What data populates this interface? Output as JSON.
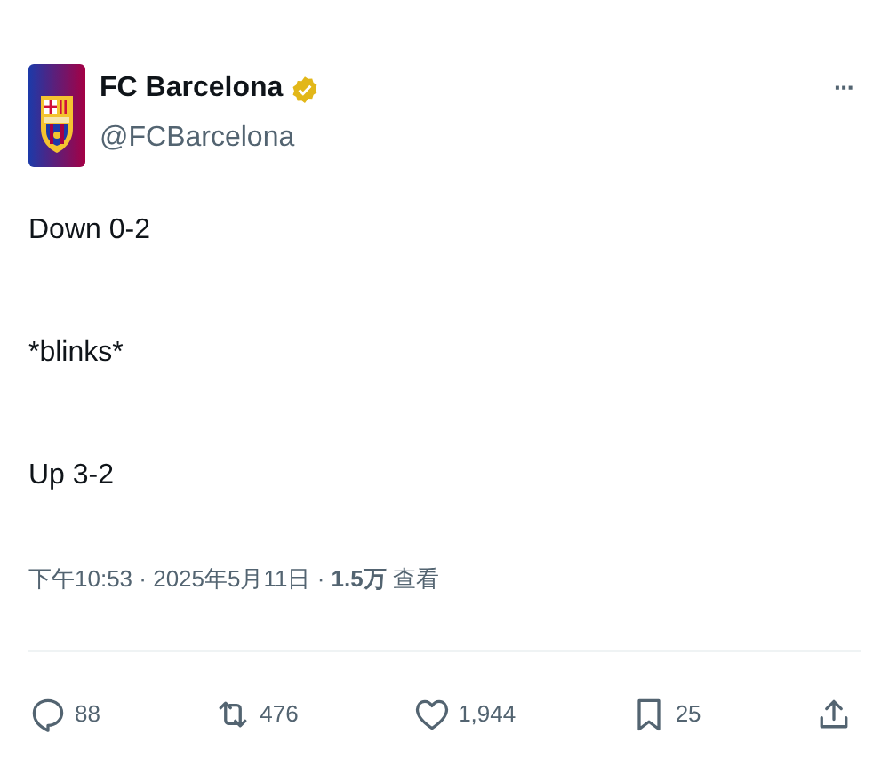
{
  "author": {
    "name": "FC Barcelona",
    "verified": true,
    "handle": "@FCBarcelona"
  },
  "more": "···",
  "lines": [
    "Down 0-2",
    "*blinks*",
    "Up 3-2"
  ],
  "meta": "下午10:53 · 2025年5月11日 · **1.5万** 查看",
  "actions": [
    {
      "kind": "reply",
      "count": "88"
    },
    {
      "kind": "repost",
      "count": "476"
    },
    {
      "kind": "like",
      "count": "1,944"
    },
    {
      "kind": "bookmark",
      "count": "25"
    },
    {
      "kind": "share"
    }
  ]
}
